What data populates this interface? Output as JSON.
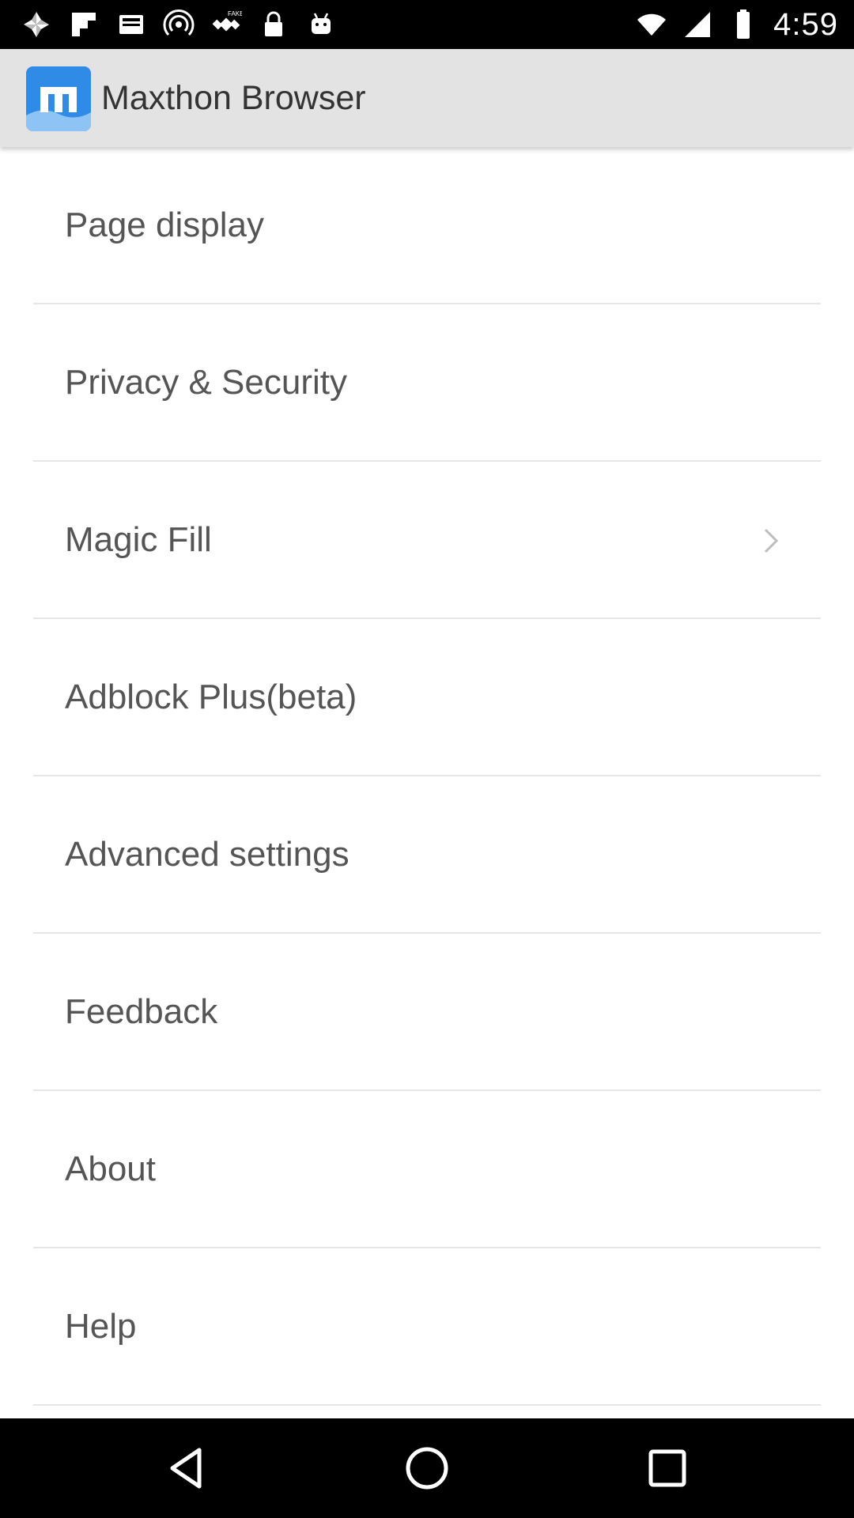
{
  "status_bar": {
    "time": "4:59",
    "left_icons": [
      "photos-icon",
      "flipboard-icon",
      "inbox-icon",
      "hotspot-icon",
      "fake-gps-icon",
      "lock-icon",
      "android-icon"
    ],
    "right_icons": [
      "wifi-icon",
      "signal-icon",
      "battery-icon"
    ]
  },
  "app_bar": {
    "title": "Maxthon Browser",
    "logo_color": "#2f8be6"
  },
  "settings": {
    "items": [
      {
        "label": "Page display"
      },
      {
        "label": "Privacy & Security"
      },
      {
        "label": "Magic Fill",
        "has_chevron": true
      },
      {
        "label": "Adblock Plus(beta)"
      },
      {
        "label": "Advanced settings"
      },
      {
        "label": "Feedback"
      },
      {
        "label": "About"
      },
      {
        "label": "Help"
      }
    ]
  },
  "nav_bar": {
    "buttons": [
      "back-icon",
      "home-icon",
      "recents-icon"
    ]
  }
}
